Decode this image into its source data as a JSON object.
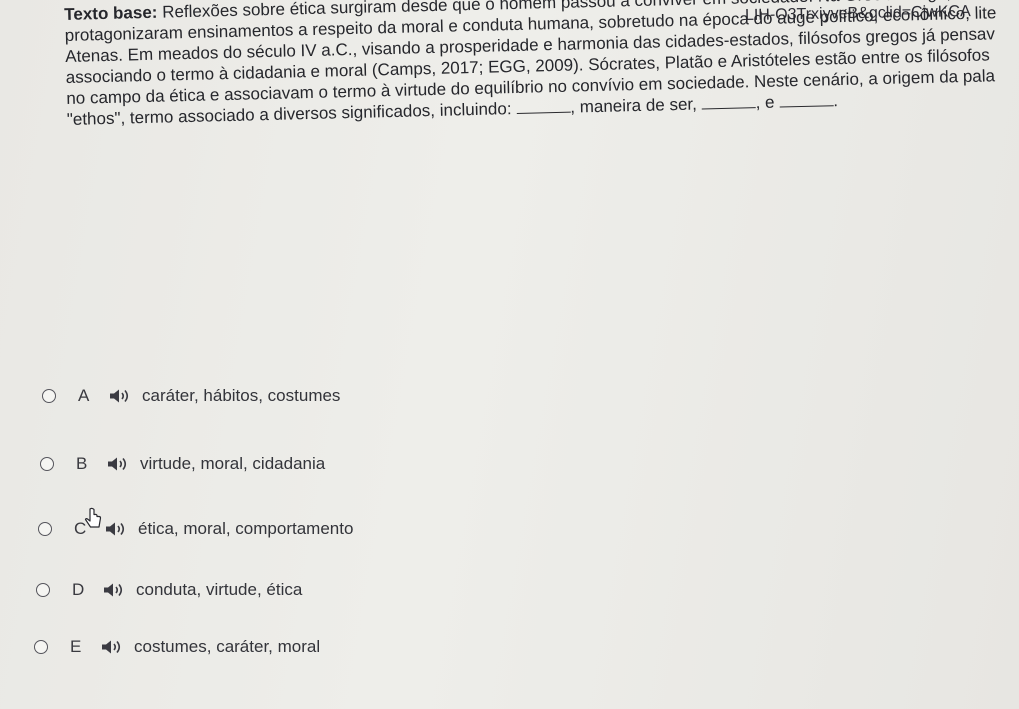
{
  "browser": {
    "url_fragment": "LIH-O3TrxiyveB&gclid=CjwKCA"
  },
  "question": {
    "label": "Texto base:",
    "line1": "Reflexões sobre ética surgiram desde que o homem passou a conviver em sociedade. Na Grécia Antiga, inúm",
    "line2": "protagonizaram ensinamentos a respeito da moral e conduta humana, sobretudo na época do auge político, econômico, lite",
    "line3": "Atenas. Em meados do século IV a.C., visando a prosperidade e harmonia das cidades-estados, filósofos gregos já pensav",
    "line4": "associando o termo à cidadania e moral (Camps, 2017; EGG, 2009). Sócrates, Platão e Aristóteles estão entre os filósofos",
    "line5": "no campo da ética e associavam o termo à virtude do equilíbrio no convívio em sociedade. Neste cenário, a origem da pala",
    "line6_part1": "\"ethos\", termo associado a diversos significados, incluindo:",
    "line6_part2": ", maneira de ser,",
    "line6_part3": ", e",
    "line6_part4": "."
  },
  "options": [
    {
      "letter": "A",
      "text": "caráter, hábitos, costumes"
    },
    {
      "letter": "B",
      "text": "virtude, moral, cidadania"
    },
    {
      "letter": "C",
      "text": "ética, moral, comportamento"
    },
    {
      "letter": "D",
      "text": "conduta, virtude, ética"
    },
    {
      "letter": "E",
      "text": "costumes, caráter, moral"
    }
  ],
  "icons": {
    "audio": "speaker-icon",
    "pointer": "mouse-cursor-icon"
  },
  "colors": {
    "text": "#26272c",
    "background": "#eceae6"
  }
}
